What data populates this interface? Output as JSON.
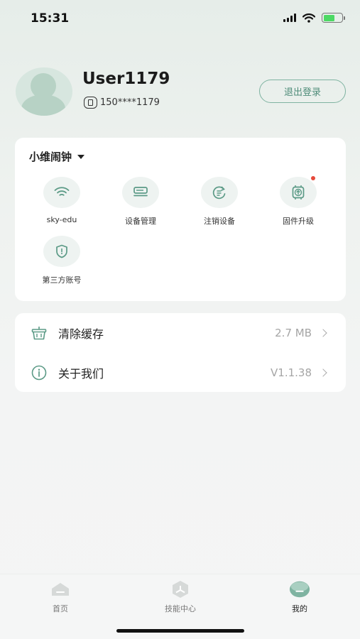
{
  "status_bar": {
    "time": "15:31"
  },
  "profile": {
    "username": "User1179",
    "phone": "150****1179",
    "logout_label": "退出登录"
  },
  "device": {
    "name": "小维闹钟",
    "tiles": [
      {
        "label": "sky-edu",
        "icon": "wifi-icon"
      },
      {
        "label": "设备管理",
        "icon": "device-manage-icon"
      },
      {
        "label": "注销设备",
        "icon": "unregister-device-icon"
      },
      {
        "label": "固件升级",
        "icon": "firmware-upgrade-icon",
        "badge": true
      },
      {
        "label": "第三方账号",
        "icon": "shield-icon"
      }
    ]
  },
  "settings": [
    {
      "title": "清除缓存",
      "value": "2.7 MB",
      "icon": "basket-icon"
    },
    {
      "title": "关于我们",
      "value": "V1.1.38",
      "icon": "info-icon"
    }
  ],
  "tabbar": [
    {
      "label": "首页",
      "icon": "home-icon",
      "active": false
    },
    {
      "label": "技能中心",
      "icon": "skills-icon",
      "active": false
    },
    {
      "label": "我的",
      "icon": "profile-tab-icon",
      "active": true
    }
  ],
  "colors": {
    "accent": "#4f8c79",
    "accent_light": "#eef3f1",
    "badge": "#e64a3b"
  }
}
